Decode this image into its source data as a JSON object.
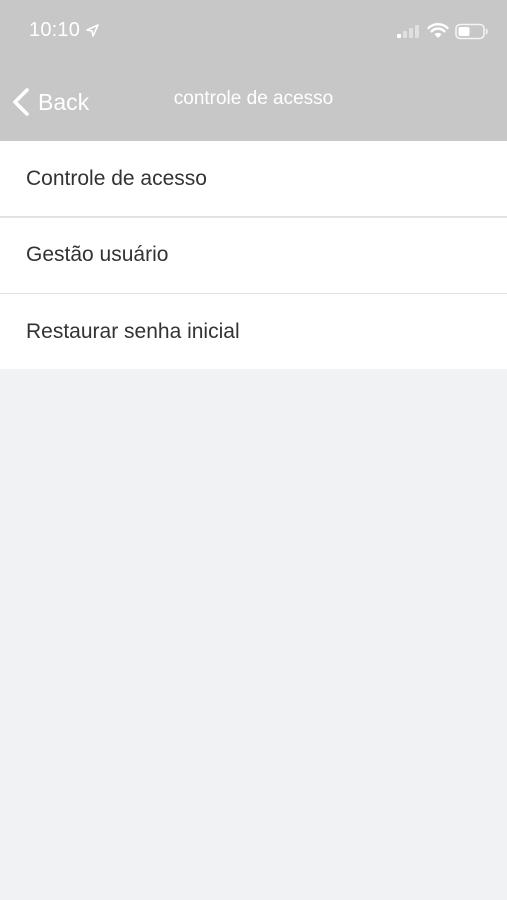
{
  "status_bar": {
    "time": "10:10",
    "icons": [
      "location-icon",
      "signal-icon",
      "wifi-icon",
      "battery-icon"
    ]
  },
  "nav": {
    "back_label": "Back",
    "title": "controle de acesso",
    "back_icon": "chevron-left-icon"
  },
  "menu": {
    "items": [
      {
        "label": "Controle de acesso"
      },
      {
        "label": "Gestão usuário"
      },
      {
        "label": "Restaurar senha inicial"
      }
    ]
  },
  "colors": {
    "header_bg": "#c7c7c7",
    "page_bg": "#f1f2f4",
    "list_bg": "#ffffff",
    "text": "#333333",
    "divider": "#e2e2e4"
  }
}
